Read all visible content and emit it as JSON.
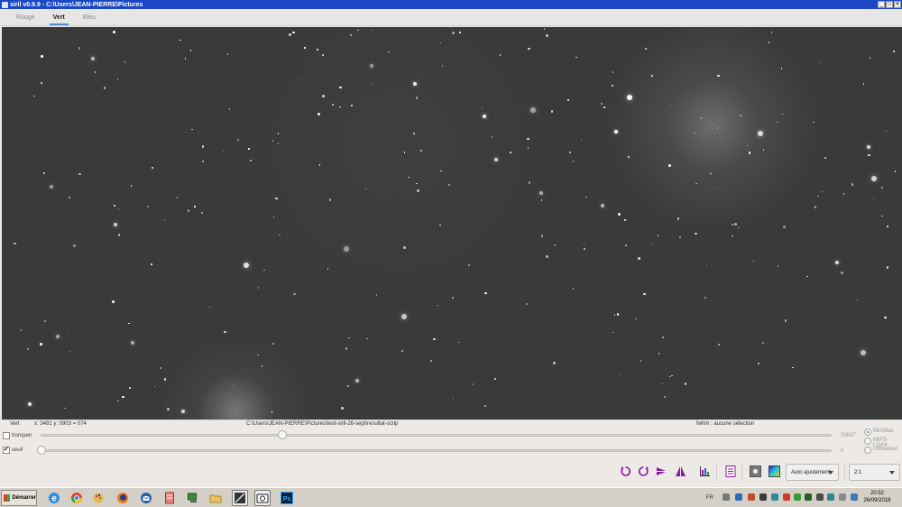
{
  "window": {
    "title": "siril v0.9.9 - C:\\Users\\JEAN-PIERRE\\Pictures",
    "buttons": {
      "minimize": "_",
      "maximize": "□",
      "close": "✕"
    }
  },
  "tabs": [
    {
      "label": "Rouge",
      "active": false
    },
    {
      "label": "Vert",
      "active": true
    },
    {
      "label": "Bleu",
      "active": false
    }
  ],
  "status": {
    "channel": "Vert",
    "coords": "x: 3481 y: 0903 = 074",
    "path": "C:\\Users\\JEAN-PIERRE\\Pictures\\test-siril-26-sept\\resultat-scrip",
    "fwhm": "fwhm : aucune sélection"
  },
  "sliders": {
    "high": {
      "label": "tronquer",
      "checked": false,
      "value": "20837",
      "position": 0.3
    },
    "low": {
      "label": "seuil",
      "checked": true,
      "value": "0",
      "position": 0.0
    }
  },
  "scale_mode": {
    "options": [
      "Min/Max",
      "MIPS-LO/HI",
      "Utilisateur"
    ],
    "selected": "Min/Max"
  },
  "toolbar": {
    "icons": [
      "rotate-left-icon",
      "rotate-right-icon",
      "mirror-x-icon",
      "mirror-y-icon",
      "histogram-icon",
      "log-icon",
      "photometry-icon",
      "color-map-icon"
    ],
    "display_mode": "Auto ajustement",
    "zoom": "2:1"
  },
  "taskbar": {
    "start_label": "Démarrer",
    "language": "FR",
    "time": "20:52",
    "date": "26/09/2018"
  },
  "colors": {
    "titlebar": "#1b48c4",
    "accent": "#4a90d9",
    "toolbar_icon": "#8a1aa0"
  }
}
